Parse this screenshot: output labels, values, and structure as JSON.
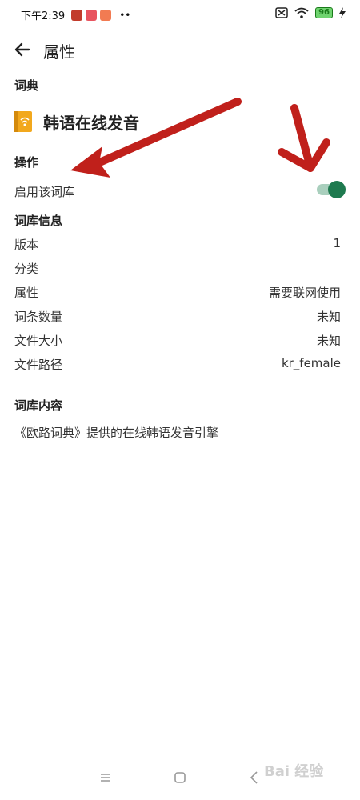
{
  "status_bar": {
    "time": "下午2:39",
    "dots": "••",
    "battery": "96"
  },
  "app_bar": {
    "title": "属性"
  },
  "sections": {
    "dictionary": "词典",
    "operation": "操作",
    "info": "词库信息",
    "content": "词库内容"
  },
  "dictionary": {
    "name": "韩语在线发音"
  },
  "operation": {
    "enable_label": "启用该词库",
    "enabled": true
  },
  "info": {
    "version_label": "版本",
    "version_value": "1",
    "category_label": "分类",
    "category_value": "",
    "property_label": "属性",
    "property_value": "需要联网使用",
    "entries_label": "词条数量",
    "entries_value": "未知",
    "size_label": "文件大小",
    "size_value": "未知",
    "path_label": "文件路径",
    "path_value": "kr_female"
  },
  "content": {
    "description": "《欧路词典》提供的在线韩语发音引擎"
  },
  "watermark": "Bai 经验",
  "colors": {
    "accent": "#1e7a4f",
    "annotation_arrow": "#c0201b",
    "dict_icon": "#f2a81d"
  }
}
